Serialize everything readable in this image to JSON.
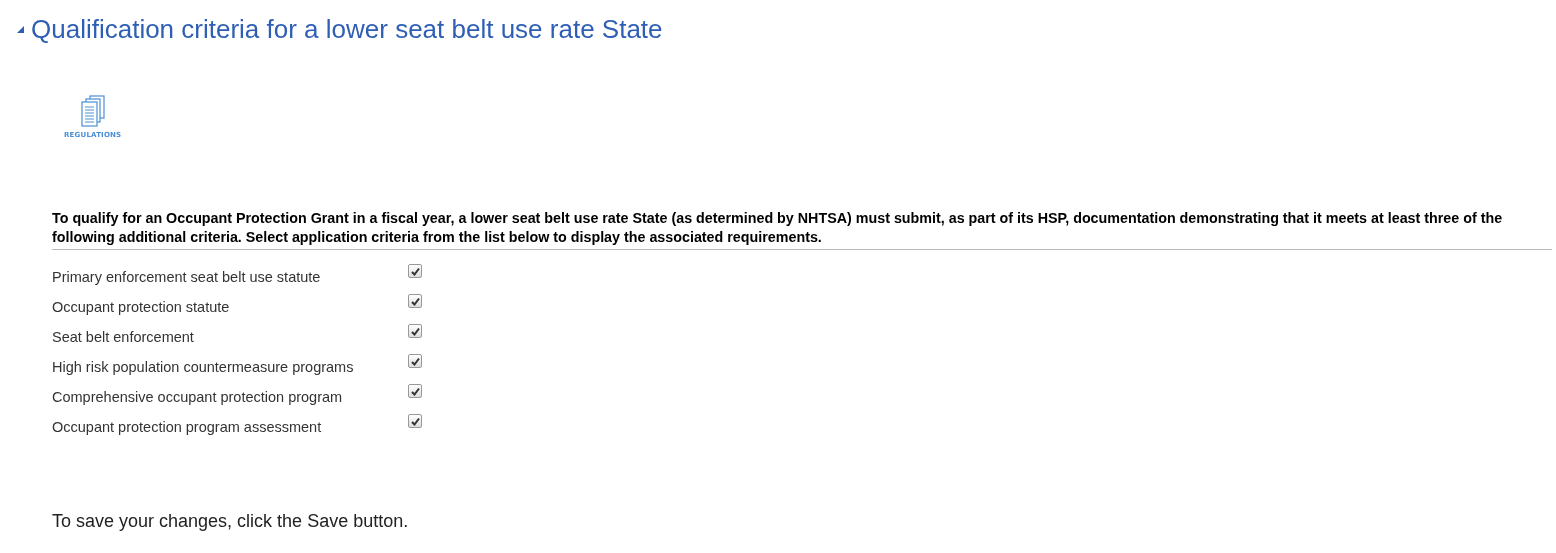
{
  "section": {
    "title": "Qualification criteria for a lower seat belt use rate State",
    "expanded": true
  },
  "regulations_link": {
    "label": "REGULATIONS"
  },
  "instructions": "To qualify for an Occupant Protection Grant in a fiscal year, a lower seat belt use rate State (as determined by NHTSA) must submit, as part of its HSP, documentation demonstrating that it meets at least three of the following additional criteria. Select application criteria from the list below to display the associated requirements.",
  "criteria": [
    {
      "label": "Primary enforcement seat belt use statute",
      "checked": true
    },
    {
      "label": "Occupant protection statute",
      "checked": true
    },
    {
      "label": "Seat belt enforcement",
      "checked": true
    },
    {
      "label": "High risk population countermeasure programs",
      "checked": true
    },
    {
      "label": "Comprehensive occupant protection program",
      "checked": true
    },
    {
      "label": "Occupant protection program assessment",
      "checked": true
    }
  ],
  "save_note": "To save your changes, click the Save button."
}
